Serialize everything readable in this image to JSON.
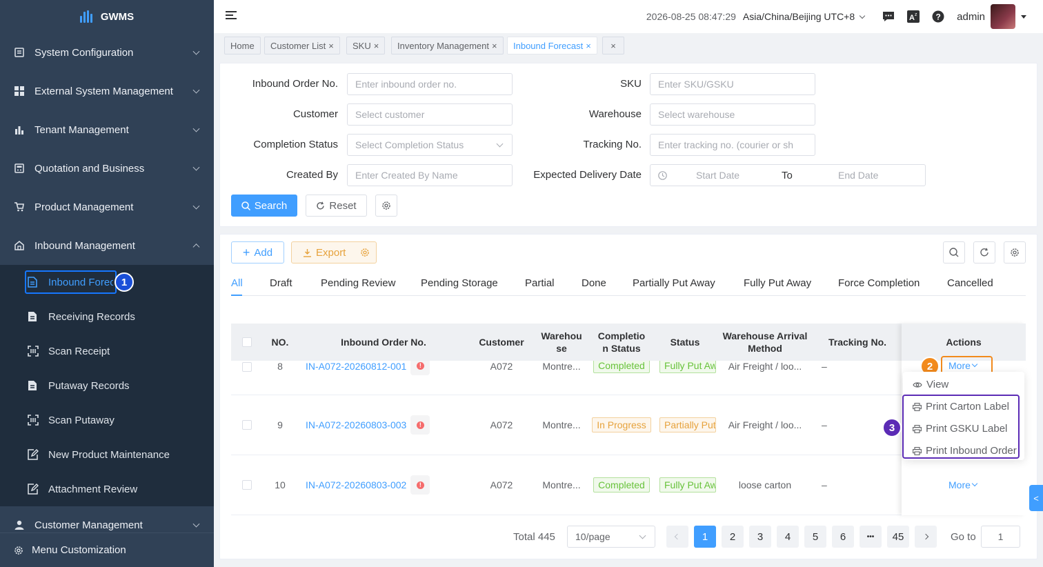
{
  "sidebar": {
    "app_name": "GWMS",
    "menu": [
      {
        "label": "System Configuration",
        "icon": "document-icon"
      },
      {
        "label": "External System Management",
        "icon": "grid-icon"
      },
      {
        "label": "Tenant Management",
        "icon": "bar-chart-icon"
      },
      {
        "label": "Quotation and Business",
        "icon": "calculator-icon"
      },
      {
        "label": "Product Management",
        "icon": "cart-icon"
      },
      {
        "label": "Inbound Management",
        "icon": "home-icon"
      }
    ],
    "submenu": [
      {
        "label": "Inbound Forecast"
      },
      {
        "label": "Receiving Records"
      },
      {
        "label": "Scan Receipt"
      },
      {
        "label": "Putaway Records"
      },
      {
        "label": "Scan Putaway"
      },
      {
        "label": "New Product Maintenance"
      },
      {
        "label": "Attachment Review"
      }
    ],
    "customer_management": "Customer Management",
    "menu_customization": "Menu Customization"
  },
  "header": {
    "datetime": "2026-08-25 08:47:29",
    "timezone": "Asia/China/Beijing UTC+8",
    "user": "admin"
  },
  "tags": [
    "Home",
    "Customer List",
    "SKU",
    "Inventory Management",
    "Inbound Forecast"
  ],
  "filters": {
    "inbound_order_label": "Inbound Order No.",
    "inbound_order_placeholder": "Enter inbound order no.",
    "sku_label": "SKU",
    "sku_placeholder": "Enter SKU/GSKU",
    "customer_label": "Customer",
    "customer_placeholder": "Select customer",
    "warehouse_label": "Warehouse",
    "warehouse_placeholder": "Select warehouse",
    "completion_label": "Completion Status",
    "completion_placeholder": "Select Completion Status",
    "tracking_label": "Tracking No.",
    "tracking_placeholder": "Enter tracking no. (courier or sh",
    "created_by_label": "Created By",
    "created_by_placeholder": "Enter Created By Name",
    "delivery_label": "Expected Delivery Date",
    "start_date": "Start Date",
    "to": "To",
    "end_date": "End Date",
    "search": "Search",
    "reset": "Reset"
  },
  "toolbar": {
    "add": "Add",
    "export": "Export"
  },
  "status_tabs": [
    "All",
    "Draft",
    "Pending Review",
    "Pending Storage",
    "Partial",
    "Done",
    "Partially Put Away",
    "Fully Put Away",
    "Force Completion",
    "Cancelled"
  ],
  "table": {
    "headers": {
      "no": "NO.",
      "order": "Inbound Order No.",
      "customer": "Customer",
      "warehouse": "Warehou se",
      "completion": "Completio n Status",
      "status": "Status",
      "arrival": "Warehouse Arrival Method",
      "tracking": "Tracking No.",
      "actions": "Actions"
    },
    "rows": [
      {
        "no": "8",
        "order": "IN-A072-20260812-001",
        "customer": "A072",
        "warehouse": "Montre...",
        "completion": "Completed",
        "status": "Fully Put Aw",
        "arrival": "Air Freight / loo...",
        "tracking": "–"
      },
      {
        "no": "9",
        "order": "IN-A072-20260803-003",
        "customer": "A072",
        "warehouse": "Montre...",
        "completion": "In Progress",
        "status": "Partially Put",
        "arrival": "Air Freight / loo...",
        "tracking": "–"
      },
      {
        "no": "10",
        "order": "IN-A072-20260803-002",
        "customer": "A072",
        "warehouse": "Montre...",
        "completion": "Completed",
        "status": "Fully Put Aw",
        "arrival": "loose carton",
        "tracking": "–"
      }
    ],
    "more": "More"
  },
  "dropdown": {
    "view": "View",
    "print_carton": "Print Carton Label",
    "print_gsku": "Print GSKU Label",
    "print_order": "Print Inbound Order"
  },
  "annotations": {
    "one": "1",
    "two": "2",
    "three": "3"
  },
  "pagination": {
    "total": "Total 445",
    "page_size": "10/page",
    "pages": [
      "1",
      "2",
      "3",
      "4",
      "5",
      "6"
    ],
    "ellipsis": "•••",
    "last": "45",
    "goto_label": "Go to",
    "goto_value": "1"
  },
  "colors": {
    "primary": "#409eff",
    "sidebar": "#304156",
    "annotation_blue": "#1a4fd8",
    "annotation_orange": "#f28a1c",
    "annotation_purple": "#5b2bb5"
  }
}
